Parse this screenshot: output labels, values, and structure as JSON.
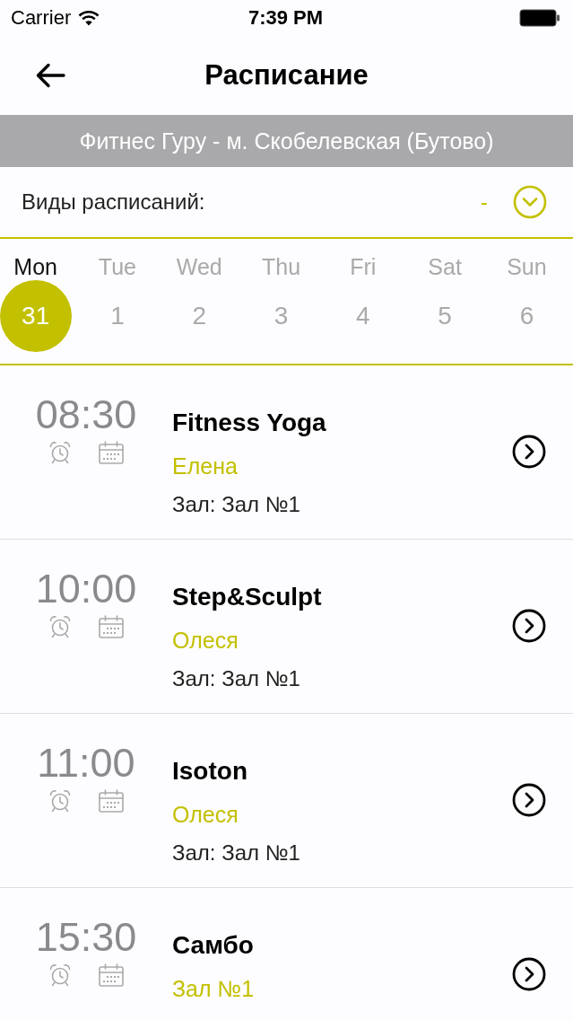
{
  "status_bar": {
    "carrier": "Carrier",
    "time": "7:39 PM"
  },
  "header": {
    "title": "Расписание"
  },
  "club": {
    "name": "Фитнес Гуру - м. Скобелевская (Бутово)"
  },
  "filter": {
    "label": "Виды расписаний:",
    "value": "-"
  },
  "week": [
    {
      "day": "Mon",
      "date": "31",
      "selected": true
    },
    {
      "day": "Tue",
      "date": "1",
      "selected": false
    },
    {
      "day": "Wed",
      "date": "2",
      "selected": false
    },
    {
      "day": "Thu",
      "date": "3",
      "selected": false
    },
    {
      "day": "Fri",
      "date": "4",
      "selected": false
    },
    {
      "day": "Sat",
      "date": "5",
      "selected": false
    },
    {
      "day": "Sun",
      "date": "6",
      "selected": false
    }
  ],
  "classes": [
    {
      "time": "08:30",
      "title": "Fitness Yoga",
      "subtitle": "Елена",
      "detail": "Зал: Зал №1"
    },
    {
      "time": "10:00",
      "title": "Step&Sculpt",
      "subtitle": "Олеся",
      "detail": "Зал: Зал №1"
    },
    {
      "time": "11:00",
      "title": "Isoton",
      "subtitle": "Олеся",
      "detail": "Зал: Зал №1"
    },
    {
      "time": "15:30",
      "title": "Самбо",
      "subtitle": "Зал №1"
    }
  ]
}
